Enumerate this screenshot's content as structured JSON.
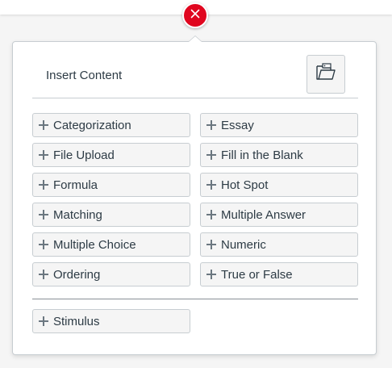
{
  "close_button": {
    "icon": "close-icon"
  },
  "panel": {
    "title": "Insert Content",
    "folder_button": {
      "icon": "folder-open-icon"
    },
    "options_left": [
      "Categorization",
      "File Upload",
      "Formula",
      "Matching",
      "Multiple Choice",
      "Ordering"
    ],
    "options_right": [
      "Essay",
      "Fill in the Blank",
      "Hot Spot",
      "Multiple Answer",
      "Numeric",
      "True or False"
    ],
    "extra_option": "Stimulus"
  },
  "colors": {
    "close_red": "#e0061f",
    "border": "#c7cdd1",
    "text": "#2d3b45"
  }
}
